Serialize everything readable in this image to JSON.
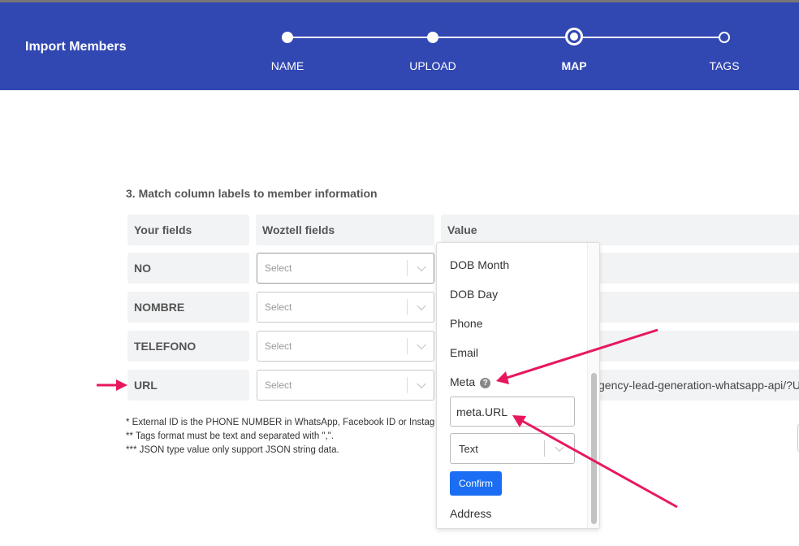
{
  "header": {
    "title": "Import Members",
    "background_color": "#3147b2",
    "steps": [
      {
        "label": "NAME",
        "state": "done"
      },
      {
        "label": "UPLOAD",
        "state": "done"
      },
      {
        "label": "MAP",
        "state": "current"
      },
      {
        "label": "TAGS",
        "state": "todo"
      }
    ]
  },
  "mapping": {
    "section_title": "3. Match column labels to member information",
    "headers": {
      "your_fields": "Your fields",
      "woztell_fields": "Woztell fields",
      "value": "Value"
    },
    "rows": [
      {
        "field": "NO",
        "select_placeholder": "Select"
      },
      {
        "field": "NOMBRE",
        "select_placeholder": "Select"
      },
      {
        "field": "TELEFONO",
        "select_placeholder": "Select"
      },
      {
        "field": "URL",
        "select_placeholder": "Select",
        "value_fragment": "gency-lead-generation-whatsapp-api/?U"
      }
    ],
    "notes": [
      "* External ID is the PHONE NUMBER in WhatsApp, Facebook ID or Instag",
      "** Tags format must be text and separated with \",\".",
      "*** JSON type value only support JSON string data."
    ]
  },
  "dropdown": {
    "options": [
      "DOB Month",
      "DOB Day",
      "Phone",
      "Email"
    ],
    "meta_label": "Meta",
    "meta_help_icon": "question-circle-icon",
    "meta_input_value": "meta.URL",
    "type_select_value": "Text",
    "confirm_label": "Confirm",
    "confirm_color": "#1b6ef3",
    "next_option": "Address"
  },
  "annotation": {
    "arrow_color": "#e8175d"
  }
}
